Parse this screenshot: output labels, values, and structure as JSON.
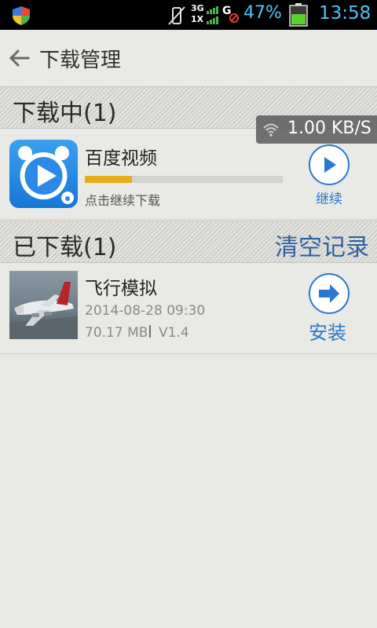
{
  "status_bar": {
    "network_top": "3G",
    "network_bottom": "1X",
    "signal_letter": "G",
    "battery_percent": "47%",
    "time": "13:58"
  },
  "header": {
    "title": "下载管理"
  },
  "downloading": {
    "section_title": "下载中(1)",
    "speed": "1.00 KB/S",
    "item": {
      "name": "百度视频",
      "progress": 0.24,
      "hint": "点击继续下载",
      "action_label": "继续"
    }
  },
  "downloaded": {
    "section_title": "已下载(1)",
    "clear_label": "清空记录",
    "item": {
      "name": "飞行模拟",
      "date": "2014-08-28 09:30",
      "size": "70.17 MB",
      "version": "V1.4",
      "action_label": "安装"
    }
  },
  "colors": {
    "accent": "#2a78cf",
    "progress": "#e7ad18",
    "status_text": "#4fc3f7"
  }
}
